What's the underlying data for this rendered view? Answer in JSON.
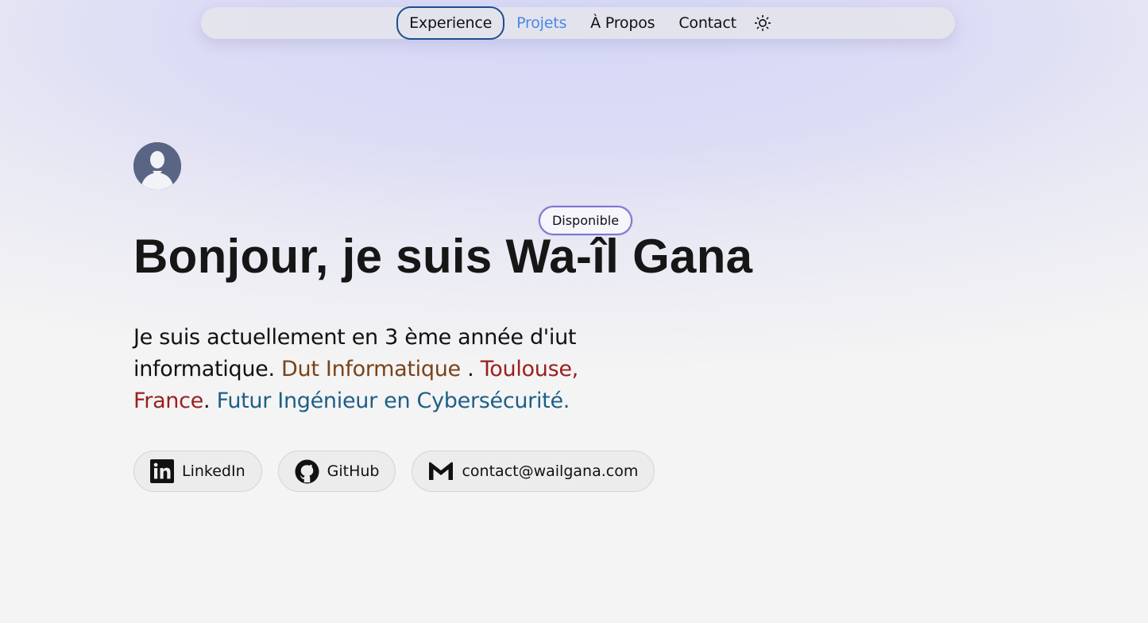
{
  "nav": {
    "items": [
      {
        "label": "Experience"
      },
      {
        "label": "Projets"
      },
      {
        "label": "À Propos"
      },
      {
        "label": "Contact"
      }
    ],
    "theme_icon": "sun-icon"
  },
  "hero": {
    "badge": "Disponible",
    "title": "Bonjour, je suis Wa-îl Gana",
    "intro_plain": "Je suis actuellement en 3 ème année d'iut informatique.",
    "intro_dut": "Dut Informatique",
    "sep1": " . ",
    "intro_city": "Toulouse, France",
    "sep2": ". ",
    "intro_future": "Futur Ingénieur en Cybersécurité."
  },
  "links": {
    "linkedin": "LinkedIn",
    "github": "GitHub",
    "email": "contact@wailgana.com"
  },
  "colors": {
    "accent_blue": "#4a86e8",
    "active_border": "#1a4f8f",
    "badge_border": "#7c78d0",
    "dut": "#7a4218",
    "city": "#9a1f1f",
    "future": "#1d5f86"
  }
}
